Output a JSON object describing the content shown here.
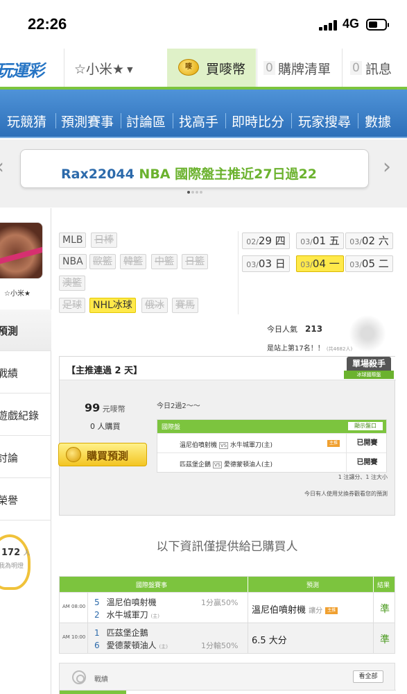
{
  "status_bar": {
    "time": "22:26",
    "network": "4G",
    "battery_level": 0.55
  },
  "top_nav": {
    "logo": "玩運彩",
    "user": "☆小米★",
    "buy_coins": "買嘜幣",
    "coin_icon_text": "嘜",
    "cart_count": "0",
    "cart_label": "購牌清單",
    "msg_count": "0",
    "msg_label": "訊息"
  },
  "menu": [
    "玩競猜",
    "預測賽事",
    "討論區",
    "找高手",
    "即時比分",
    "玩家搜尋",
    "數據"
  ],
  "banner": {
    "user": "Rax22044",
    "text": " NBA 國際盤主推近27日過22",
    "dot_count": 4,
    "active_dot": 0
  },
  "sidebar": {
    "avatar_name": "☆小米★",
    "items": [
      "預測",
      "戰績",
      "遊戲紀錄",
      "討論",
      "榮譽"
    ],
    "active_index": 0,
    "bulb_count": "172",
    "bulb_unit": "人",
    "bulb_sub": "我為明燈"
  },
  "leagues": {
    "row1": [
      {
        "label": "MLB",
        "state": "normal"
      },
      {
        "label": "日棒",
        "state": "off"
      }
    ],
    "row2": [
      {
        "label": "NBA",
        "state": "normal"
      },
      {
        "label": "歐籃",
        "state": "off"
      },
      {
        "label": "韓籃",
        "state": "off"
      },
      {
        "label": "中籃",
        "state": "off"
      },
      {
        "label": "日籃",
        "state": "off"
      }
    ],
    "row3": [
      {
        "label": "澳籃",
        "state": "off"
      }
    ],
    "row4": [
      {
        "label": "足球",
        "state": "off"
      },
      {
        "label": "NHL冰球",
        "state": "on"
      },
      {
        "label": "俄冰",
        "state": "off"
      },
      {
        "label": "賽馬",
        "state": "off"
      }
    ]
  },
  "dates": [
    {
      "m": "02/",
      "d": "29",
      "w": "四",
      "selected": false
    },
    {
      "m": "03/",
      "d": "01",
      "w": "五",
      "selected": false
    },
    {
      "m": "03/",
      "d": "02",
      "w": "六",
      "selected": false
    },
    {
      "m": "03/",
      "d": "03",
      "w": "日",
      "selected": false
    },
    {
      "m": "03/",
      "d": "04",
      "w": "一",
      "selected": true
    },
    {
      "m": "03/",
      "d": "05",
      "w": "二",
      "selected": false
    }
  ],
  "stats": {
    "popularity_label": "今日人氣",
    "popularity_value": "213",
    "rank_text": "是站上第17名！！",
    "rank_small": "(共4682人)"
  },
  "panel": {
    "title": "【主推連過 2 天】",
    "badge_top": "單場殺手",
    "badge_bottom": "冰球國際盤",
    "price_value": "99",
    "price_unit": "元嘜幣",
    "buyers": "0 人購買",
    "buy_button": "購買預測",
    "today_text": "今日2過2～～",
    "table_title": "國際盤",
    "show_button": "顯示盤口",
    "matches": [
      {
        "home": "溫尼伯噴射機",
        "away": "水牛城軍刀(主)",
        "status": "已開賽",
        "flag": "主推"
      },
      {
        "home": "匹茲堡企鵝",
        "away": "愛德蒙頓油人(主)",
        "status": "已開賽",
        "flag": ""
      }
    ],
    "vs_label": "VS",
    "rule_text": "1 注讓分、1 注大小",
    "coupon_text": "今日有人使用兌換券觀看您的預測"
  },
  "purchaser_note": "以下資訊僅提供給已購買人",
  "results": {
    "headers": [
      "國際盤賽事",
      "預測",
      "結果"
    ],
    "rows": [
      {
        "time": "AM 08:00",
        "t1_num": "5",
        "t1_name": "溫尼伯噴射機",
        "odds": "1分贏50%",
        "t2_num": "2",
        "t2_name": "水牛城軍刀",
        "t2_tag": "(主)",
        "prediction": "溫尼伯噴射機",
        "pred_type": "讓分",
        "pred_flag": "主推",
        "result": "準"
      },
      {
        "time": "AM 10:00",
        "t1_num": "1",
        "t1_name": "匹茲堡企鵝",
        "odds": "1分輸50%",
        "t2_num": "6",
        "t2_name": "愛德蒙頓油人",
        "t2_tag": "(主)",
        "prediction": "6.5 大分",
        "pred_type": "",
        "pred_flag": "",
        "result": "準"
      }
    ]
  },
  "record": {
    "label": "戰績",
    "see_all": "看全部"
  }
}
